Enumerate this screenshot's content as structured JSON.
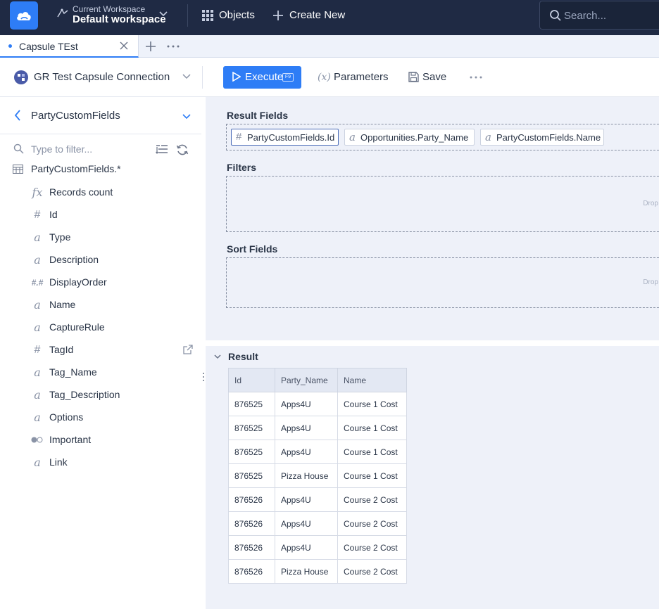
{
  "topbar": {
    "workspace_label": "Current Workspace",
    "workspace_value": "Default workspace",
    "objects_label": "Objects",
    "create_label": "Create New",
    "search_placeholder": "Search..."
  },
  "tabs": [
    {
      "label": "Capsule TEst",
      "active": true
    }
  ],
  "toolbar": {
    "connection": "GR Test Capsule Connection",
    "execute_label": "Execute",
    "execute_shortcut": "F9",
    "parameters_icon": "(x)",
    "parameters_label": "Parameters",
    "save_label": "Save"
  },
  "left": {
    "breadcrumb": "PartyCustomFields",
    "filter_placeholder": "Type to filter...",
    "root": "PartyCustomFields.*",
    "fields": [
      {
        "icon": "fx",
        "label": "Records count"
      },
      {
        "icon": "#",
        "label": "Id"
      },
      {
        "icon": "a",
        "label": "Type"
      },
      {
        "icon": "a",
        "label": "Description"
      },
      {
        "icon": "#.#",
        "label": "DisplayOrder"
      },
      {
        "icon": "a",
        "label": "Name"
      },
      {
        "icon": "a",
        "label": "CaptureRule"
      },
      {
        "icon": "#",
        "label": "TagId"
      },
      {
        "icon": "a",
        "label": "Tag_Name"
      },
      {
        "icon": "a",
        "label": "Tag_Description"
      },
      {
        "icon": "a",
        "label": "Options"
      },
      {
        "icon": "toggle",
        "label": "Important"
      },
      {
        "icon": "a",
        "label": "Link"
      }
    ]
  },
  "query": {
    "result_fields_title": "Result Fields",
    "result_fields": [
      {
        "icon": "#",
        "label": "PartyCustomFields.Id"
      },
      {
        "icon": "a",
        "label": "Opportunities.Party_Name"
      },
      {
        "icon": "a",
        "label": "PartyCustomFields.Name"
      }
    ],
    "filters_title": "Filters",
    "sort_title": "Sort Fields",
    "drop_hint": "Drop"
  },
  "result": {
    "title": "Result",
    "columns": [
      "Id",
      "Party_Name",
      "Name"
    ],
    "rows": [
      [
        "876525",
        "Apps4U",
        "Course 1 Cost"
      ],
      [
        "876525",
        "Apps4U",
        "Course 1 Cost"
      ],
      [
        "876525",
        "Apps4U",
        "Course 1 Cost"
      ],
      [
        "876525",
        "Pizza House",
        "Course 1 Cost"
      ],
      [
        "876526",
        "Apps4U",
        "Course 2 Cost"
      ],
      [
        "876526",
        "Apps4U",
        "Course 2 Cost"
      ],
      [
        "876526",
        "Apps4U",
        "Course 2 Cost"
      ],
      [
        "876526",
        "Pizza House",
        "Course 2 Cost"
      ]
    ]
  }
}
